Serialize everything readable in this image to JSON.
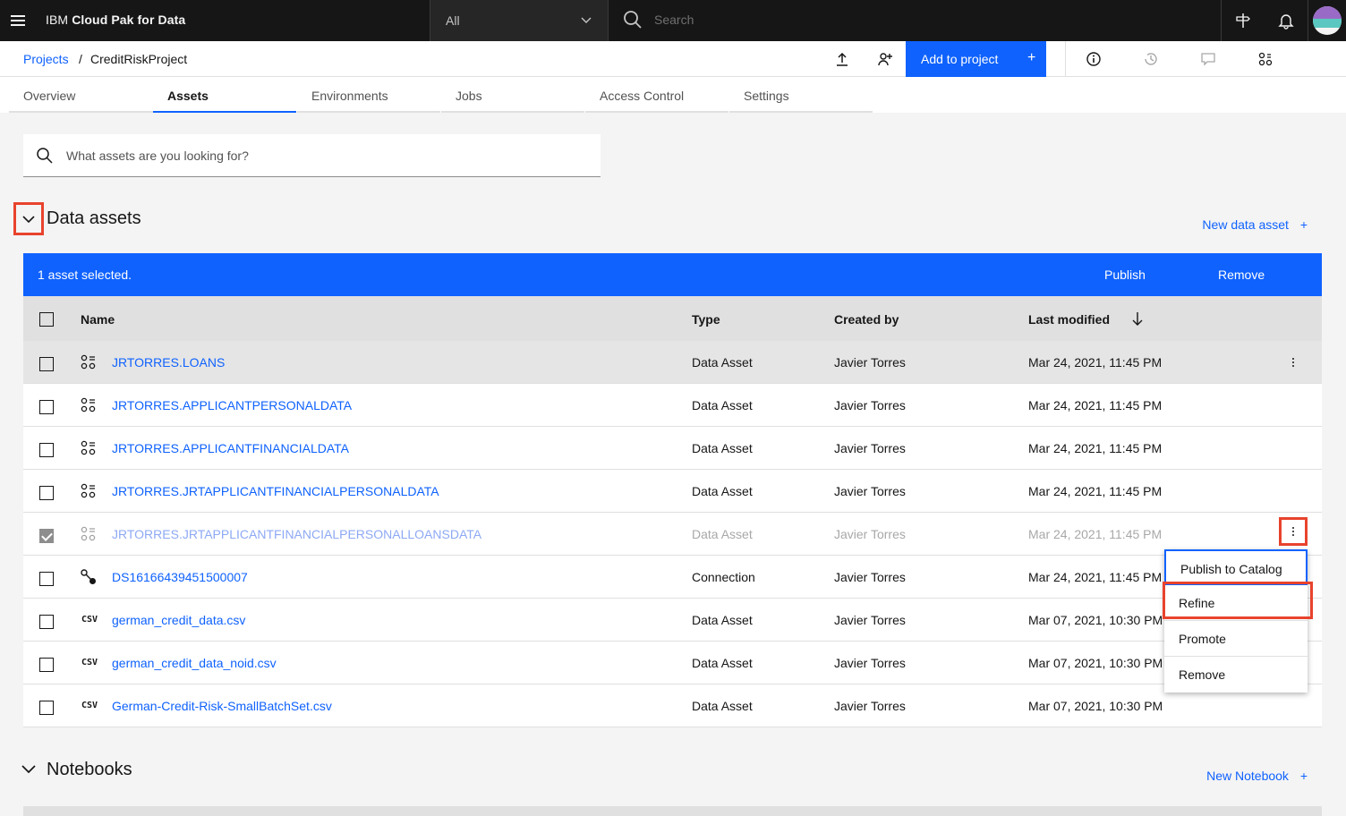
{
  "topbar": {
    "brand_prefix": "IBM",
    "brand_name": "Cloud Pak for Data",
    "scope_value": "All",
    "search_placeholder": "Search"
  },
  "breadcrumb": {
    "root": "Projects",
    "separator": "/",
    "current": "CreditRiskProject"
  },
  "header": {
    "add_button": "Add to project",
    "add_button_icon": "+"
  },
  "tabs": [
    "Overview",
    "Assets",
    "Environments",
    "Jobs",
    "Access Control",
    "Settings"
  ],
  "active_tab": "Assets",
  "asset_search": {
    "placeholder": "What assets are you looking for?"
  },
  "data_assets": {
    "title": "Data assets",
    "new_label": "New data asset",
    "new_icon": "+",
    "selection_text": "1 asset selected.",
    "batch_actions": [
      "Publish",
      "Remove"
    ],
    "columns": {
      "name": "Name",
      "type": "Type",
      "created_by": "Created by",
      "last_modified": "Last modified"
    },
    "rows": [
      {
        "name": "JRTORRES.LOANS",
        "type": "Data Asset",
        "created_by": "Javier Torres",
        "modified": "Mar 24, 2021, 11:45 PM",
        "icon": "data-asset-icon"
      },
      {
        "name": "JRTORRES.APPLICANTPERSONALDATA",
        "type": "Data Asset",
        "created_by": "Javier Torres",
        "modified": "Mar 24, 2021, 11:45 PM",
        "icon": "data-asset-icon"
      },
      {
        "name": "JRTORRES.APPLICANTFINANCIALDATA",
        "type": "Data Asset",
        "created_by": "Javier Torres",
        "modified": "Mar 24, 2021, 11:45 PM",
        "icon": "data-asset-icon"
      },
      {
        "name": "JRTORRES.JRTAPPLICANTFINANCIALPERSONALDATA",
        "type": "Data Asset",
        "created_by": "Javier Torres",
        "modified": "Mar 24, 2021, 11:45 PM",
        "icon": "data-asset-icon"
      },
      {
        "name": "JRTORRES.JRTAPPLICANTFINANCIALPERSONALLOANSDATA",
        "type": "Data Asset",
        "created_by": "Javier Torres",
        "modified": "Mar 24, 2021, 11:45 PM",
        "icon": "data-asset-icon",
        "selected": true
      },
      {
        "name": "DS16166439451500007",
        "type": "Connection",
        "created_by": "Javier Torres",
        "modified": "Mar 24, 2021, 11:45 PM",
        "icon": "connection-icon"
      },
      {
        "name": "german_credit_data.csv",
        "type": "Data Asset",
        "created_by": "Javier Torres",
        "modified": "Mar 07, 2021, 10:30 PM",
        "icon": "csv-icon"
      },
      {
        "name": "german_credit_data_noid.csv",
        "type": "Data Asset",
        "created_by": "Javier Torres",
        "modified": "Mar 07, 2021, 10:30 PM",
        "icon": "csv-icon"
      },
      {
        "name": "German-Credit-Risk-SmallBatchSet.csv",
        "type": "Data Asset",
        "created_by": "Javier Torres",
        "modified": "Mar 07, 2021, 10:30 PM",
        "icon": "csv-icon"
      }
    ],
    "csv_icon_text": "CSV"
  },
  "overflow_menu": [
    "Publish to Catalog",
    "Refine",
    "Promote",
    "Remove"
  ],
  "notebooks": {
    "title": "Notebooks",
    "new_label": "New Notebook",
    "new_icon": "+"
  },
  "colors": {
    "primary": "#0f62fe",
    "highlight": "#e8432d",
    "topbar": "#161616"
  }
}
